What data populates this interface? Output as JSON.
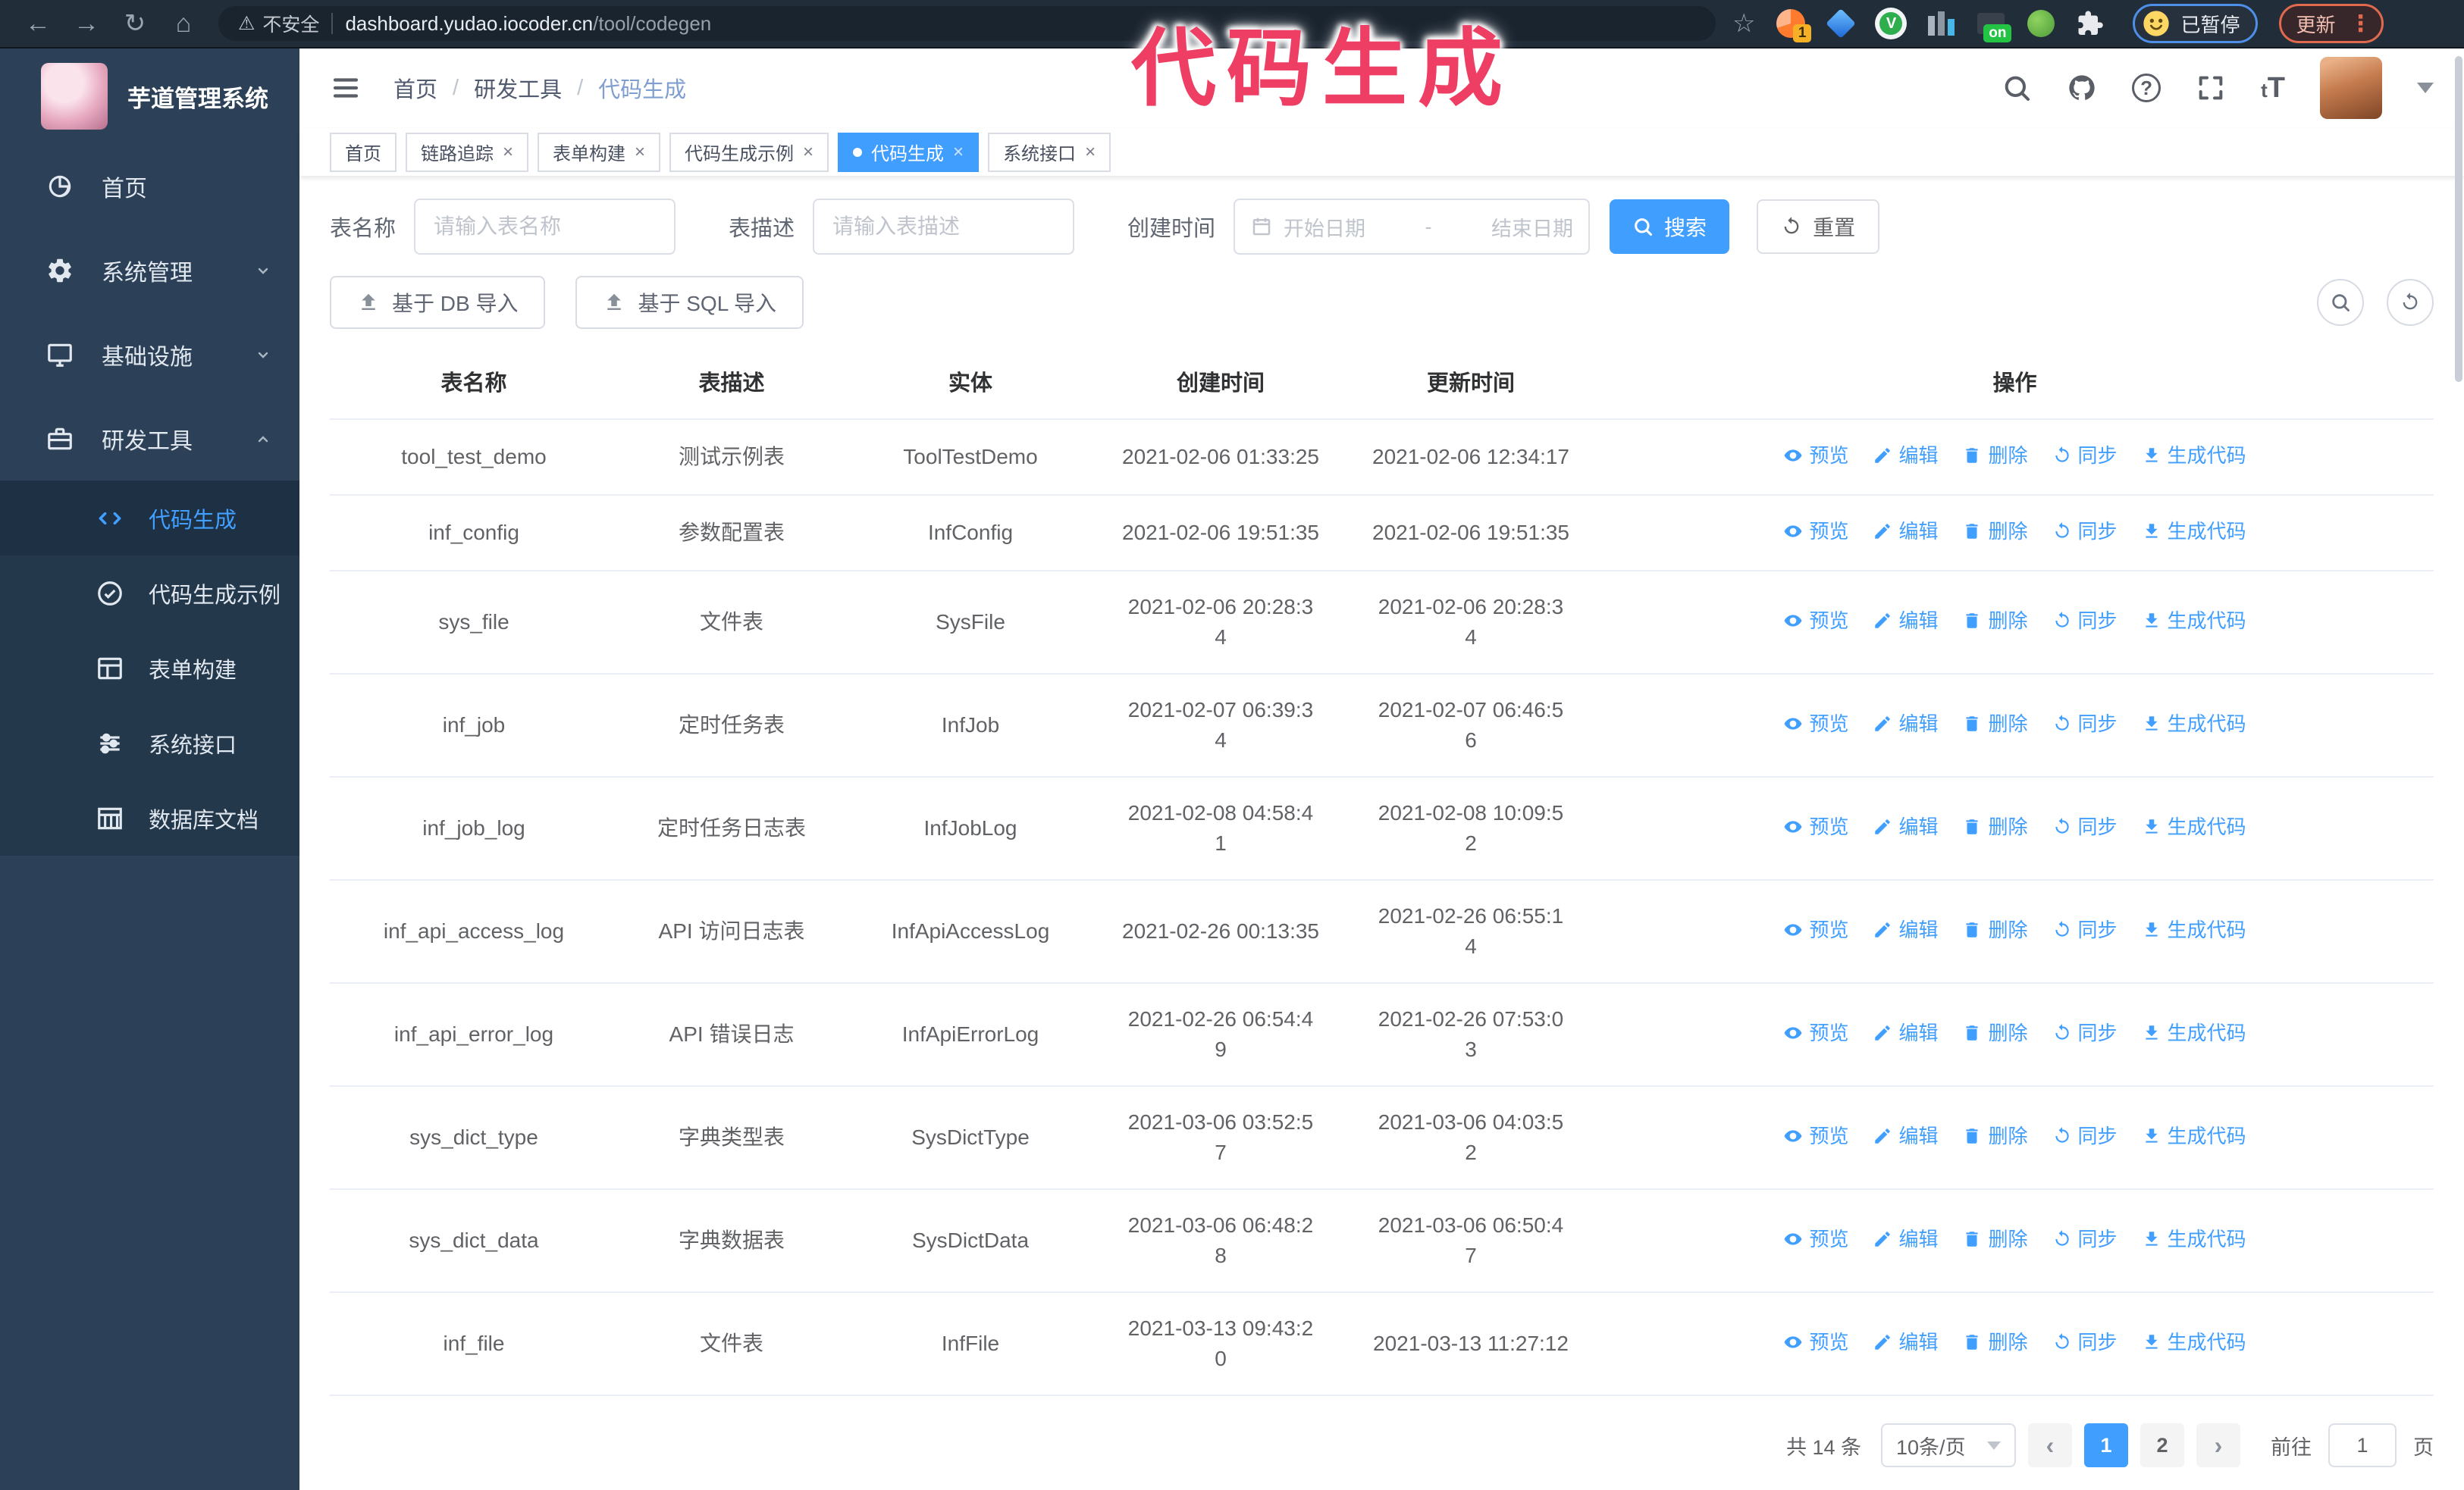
{
  "annotation": {
    "text": "代码生成",
    "color": "#ee3e63"
  },
  "browser": {
    "security_label": "不安全",
    "url_host": "dashboard.yudao.iocoder.cn",
    "url_path": "/tool/codegen",
    "ext_badge_count": "1",
    "ext_on_label": "on",
    "paused_label": "已暂停",
    "update_label": "更新"
  },
  "sidebar": {
    "app_title": "芋道管理系统",
    "items": [
      {
        "label": "首页",
        "icon": "dashboard-icon",
        "chevron": ""
      },
      {
        "label": "系统管理",
        "icon": "gear-icon",
        "chevron": "down"
      },
      {
        "label": "基础设施",
        "icon": "monitor-icon",
        "chevron": "down"
      },
      {
        "label": "研发工具",
        "icon": "toolbox-icon",
        "chevron": "up"
      }
    ],
    "subitems": [
      {
        "label": "代码生成",
        "icon": "code-icon",
        "active": true
      },
      {
        "label": "代码生成示例",
        "icon": "check-circle-icon",
        "active": false
      },
      {
        "label": "表单构建",
        "icon": "form-icon",
        "active": false
      },
      {
        "label": "系统接口",
        "icon": "sliders-icon",
        "active": false
      },
      {
        "label": "数据库文档",
        "icon": "database-doc-icon",
        "active": false
      }
    ]
  },
  "header": {
    "breadcrumb": [
      "首页",
      "研发工具",
      "代码生成"
    ],
    "font_size_label": "tT"
  },
  "tabs": [
    {
      "label": "首页",
      "closable": false,
      "active": false
    },
    {
      "label": "链路追踪",
      "closable": true,
      "active": false
    },
    {
      "label": "表单构建",
      "closable": true,
      "active": false
    },
    {
      "label": "代码生成示例",
      "closable": true,
      "active": false
    },
    {
      "label": "代码生成",
      "closable": true,
      "active": true
    },
    {
      "label": "系统接口",
      "closable": true,
      "active": false
    }
  ],
  "filters": {
    "name_label": "表名称",
    "name_placeholder": "请输入表名称",
    "desc_label": "表描述",
    "desc_placeholder": "请输入表描述",
    "time_label": "创建时间",
    "start_placeholder": "开始日期",
    "range_separator": "-",
    "end_placeholder": "结束日期",
    "search_label": "搜索",
    "reset_label": "重置"
  },
  "toolbar": {
    "db_import_label": "基于 DB 导入",
    "sql_import_label": "基于 SQL 导入"
  },
  "table": {
    "columns": [
      "表名称",
      "表描述",
      "实体",
      "创建时间",
      "更新时间",
      "操作"
    ],
    "action_labels": [
      "预览",
      "编辑",
      "删除",
      "同步",
      "生成代码"
    ],
    "rows": [
      {
        "name": "tool_test_demo",
        "desc": "测试示例表",
        "entity": "ToolTestDemo",
        "created": "2021-02-06 01:33:25",
        "updated": "2021-02-06 12:34:17"
      },
      {
        "name": "inf_config",
        "desc": "参数配置表",
        "entity": "InfConfig",
        "created": "2021-02-06 19:51:35",
        "updated": "2021-02-06 19:51:35"
      },
      {
        "name": "sys_file",
        "desc": "文件表",
        "entity": "SysFile",
        "created": "2021-02-06 20:28:3\n4",
        "updated": "2021-02-06 20:28:3\n4"
      },
      {
        "name": "inf_job",
        "desc": "定时任务表",
        "entity": "InfJob",
        "created": "2021-02-07 06:39:3\n4",
        "updated": "2021-02-07 06:46:5\n6"
      },
      {
        "name": "inf_job_log",
        "desc": "定时任务日志表",
        "entity": "InfJobLog",
        "created": "2021-02-08 04:58:4\n1",
        "updated": "2021-02-08 10:09:5\n2"
      },
      {
        "name": "inf_api_access_log",
        "desc": "API 访问日志表",
        "entity": "InfApiAccessLog",
        "created": "2021-02-26 00:13:35",
        "updated": "2021-02-26 06:55:1\n4"
      },
      {
        "name": "inf_api_error_log",
        "desc": "API 错误日志",
        "entity": "InfApiErrorLog",
        "created": "2021-02-26 06:54:4\n9",
        "updated": "2021-02-26 07:53:0\n3"
      },
      {
        "name": "sys_dict_type",
        "desc": "字典类型表",
        "entity": "SysDictType",
        "created": "2021-03-06 03:52:5\n7",
        "updated": "2021-03-06 04:03:5\n2"
      },
      {
        "name": "sys_dict_data",
        "desc": "字典数据表",
        "entity": "SysDictData",
        "created": "2021-03-06 06:48:2\n8",
        "updated": "2021-03-06 06:50:4\n7"
      },
      {
        "name": "inf_file",
        "desc": "文件表",
        "entity": "InfFile",
        "created": "2021-03-13 09:43:2\n0",
        "updated": "2021-03-13 11:27:12"
      }
    ]
  },
  "pagination": {
    "total": "共 14 条",
    "page_size": "10条/页",
    "pages": [
      "1",
      "2"
    ],
    "active_index": 0,
    "goto_label": "前往",
    "goto_value": "1",
    "unit_label": "页"
  },
  "colors": {
    "primary": "#409eff",
    "sidebar_bg": "#2c4157",
    "annotation": "#ee3e63"
  }
}
